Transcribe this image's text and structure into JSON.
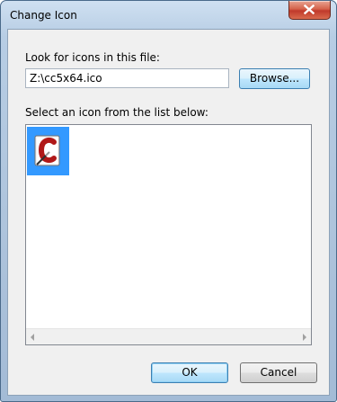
{
  "window": {
    "title": "Change Icon"
  },
  "form": {
    "look_for_label": "Look for icons in this file:",
    "file_path": "Z:\\cc5x64.ico",
    "browse_label": "Browse...",
    "select_label": "Select an icon from the list below:"
  },
  "icons": [
    {
      "name": "cc5x64-icon",
      "selected": true
    }
  ],
  "buttons": {
    "ok_label": "OK",
    "cancel_label": "Cancel"
  },
  "colors": {
    "selection": "#3399ff",
    "close_button": "#c0392b"
  }
}
